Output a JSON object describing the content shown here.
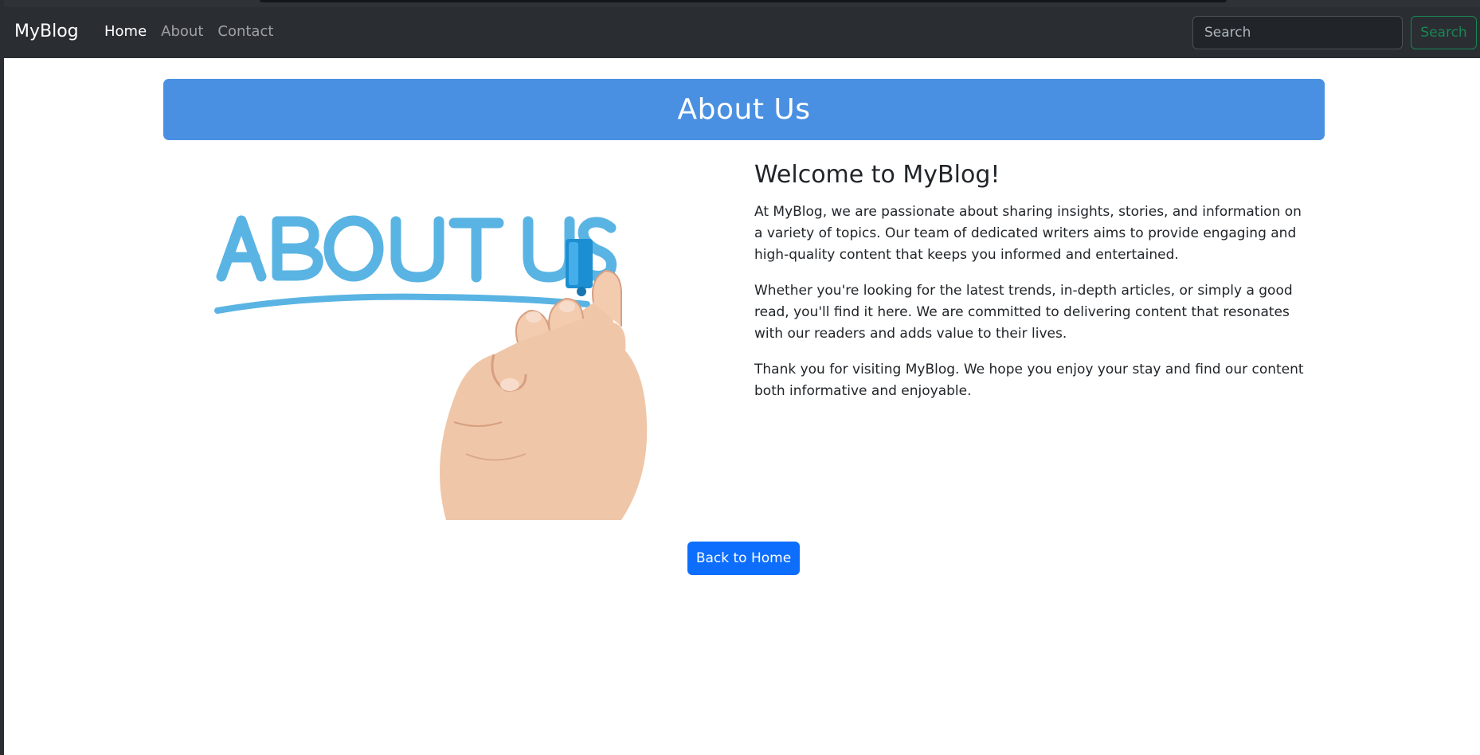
{
  "navbar": {
    "brand": "MyBlog",
    "links": [
      {
        "label": "Home",
        "active": true
      },
      {
        "label": "About",
        "active": false
      },
      {
        "label": "Contact",
        "active": false
      }
    ],
    "search_placeholder": "Search",
    "search_button": "Search"
  },
  "banner": {
    "title": "About Us"
  },
  "image": {
    "lettering": "ABOUT US",
    "icon": "hand-drawing-marker-illustration"
  },
  "content": {
    "heading": "Welcome to MyBlog!",
    "paragraphs": [
      "At MyBlog, we are passionate about sharing insights, stories, and information on a variety of topics. Our team of dedicated writers aims to provide engaging and high-quality content that keeps you informed and entertained.",
      "Whether you're looking for the latest trends, in-depth articles, or simply a good read, you'll find it here. We are committed to delivering content that resonates with our readers and adds value to their lives.",
      "Thank you for visiting MyBlog. We hope you enjoy your stay and find our content both informative and enjoyable."
    ]
  },
  "back_button": "Back to Home",
  "colors": {
    "navbar_bg": "#2a2e33",
    "banner_bg": "#4a90e2",
    "primary": "#0d6efd",
    "success": "#198754",
    "image_blue": "#5ab4e3"
  }
}
